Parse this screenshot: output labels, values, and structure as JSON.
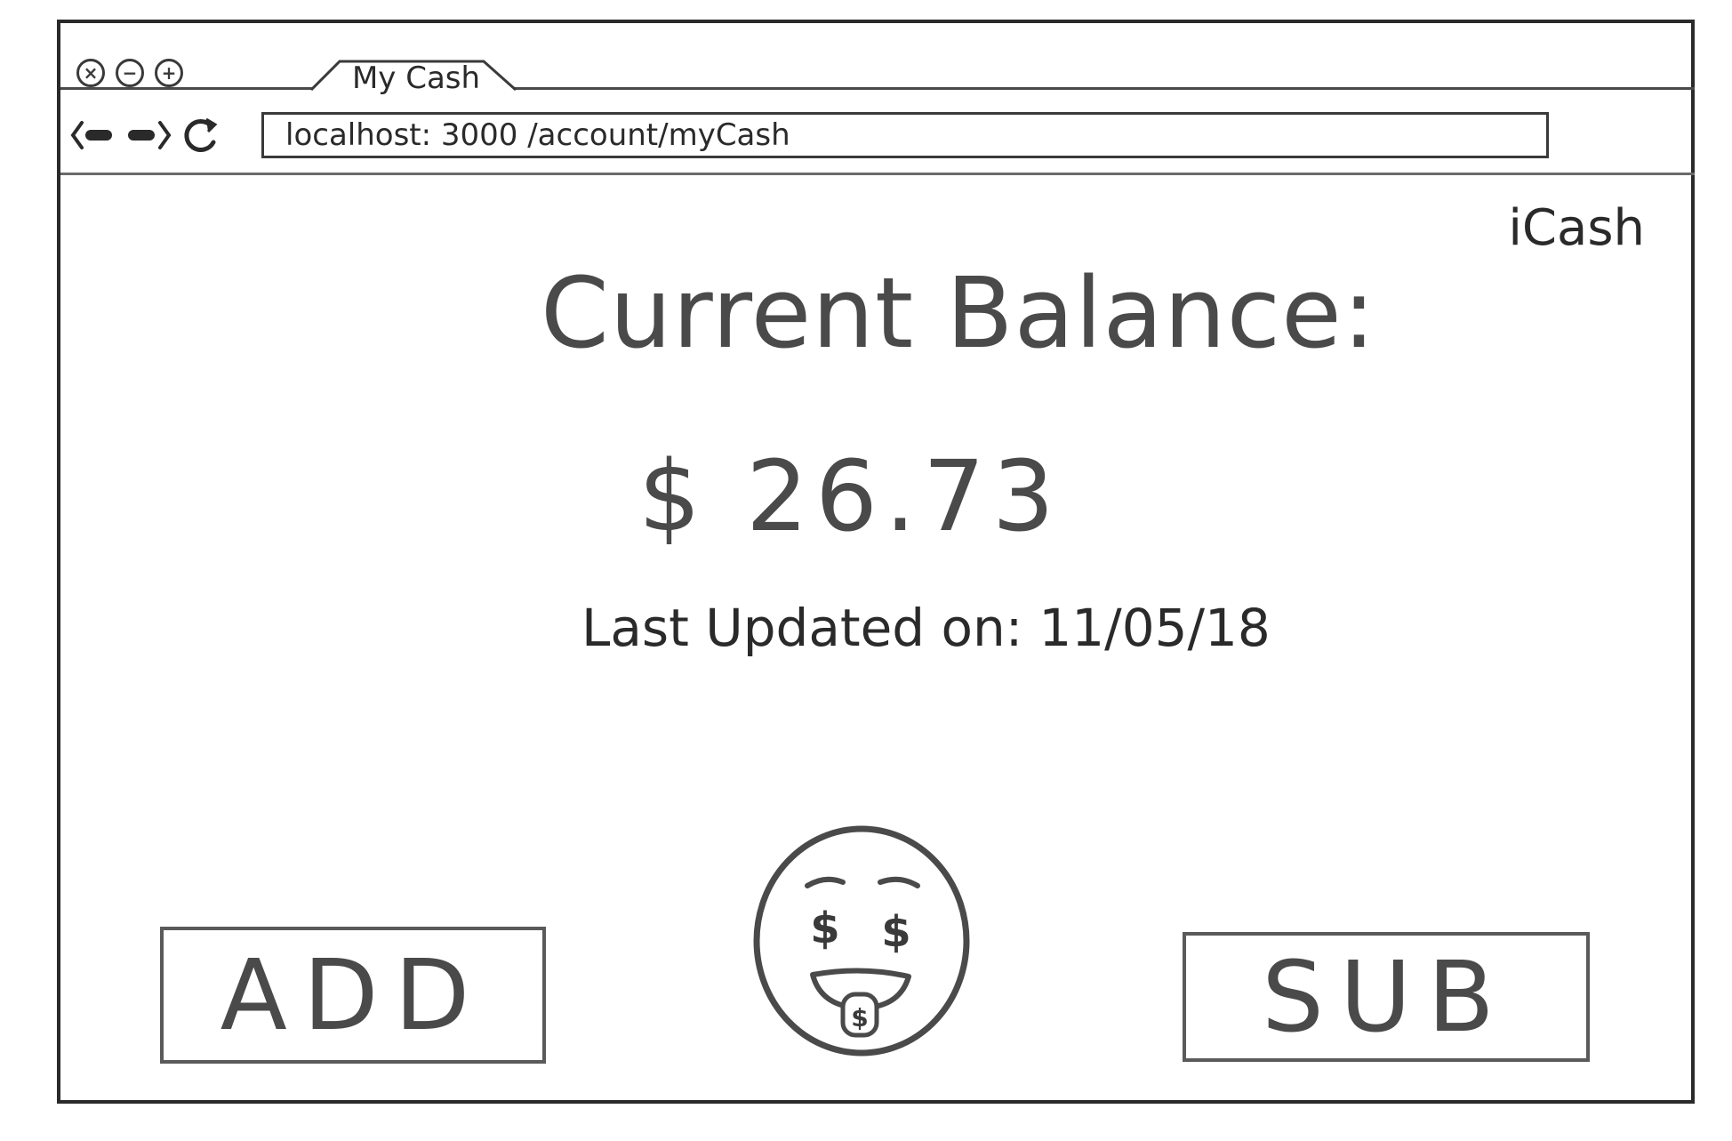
{
  "window": {
    "controls": {
      "close_symbol": "×",
      "minimize_symbol": "−",
      "maximize_symbol": "+"
    }
  },
  "tab": {
    "title": "My Cash"
  },
  "address_bar": {
    "url": "localhost: 3000 /account/myCash"
  },
  "header": {
    "brand": "iCash"
  },
  "balance": {
    "label": "Current Balance:",
    "currency_symbol": "$",
    "amount": "26.73"
  },
  "last_updated": {
    "label": "Last Updated on:",
    "date": "11/05/18"
  },
  "actions": {
    "add_label": "ADD",
    "sub_label": "SUB"
  },
  "mascot": {
    "icon": "money-face-emoji",
    "eye_symbol": "$",
    "tongue_symbol": "$"
  },
  "colors": {
    "ink": "#3a3a3a",
    "frame": "#2a2a2a",
    "button_border": "#5a5a5a"
  }
}
